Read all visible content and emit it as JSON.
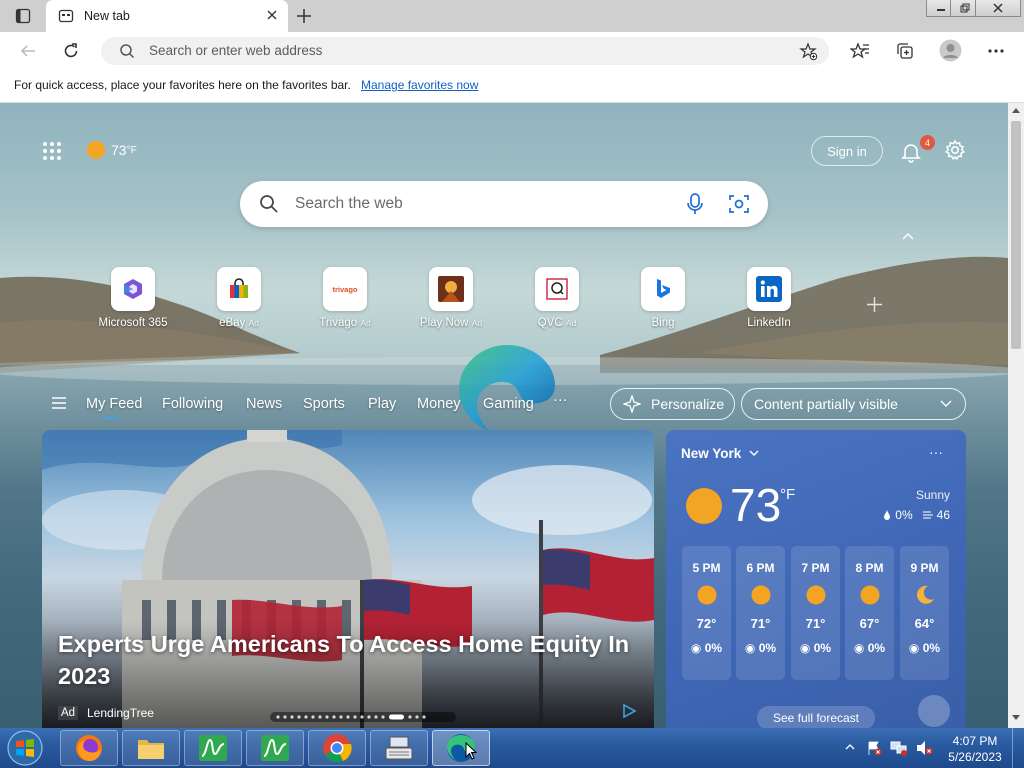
{
  "browser": {
    "tab_title": "New tab",
    "address_placeholder": "Search or enter web address",
    "favorites_message": "For quick access, place your favorites here on the favorites bar.",
    "favorites_link": "Manage favorites now"
  },
  "ntp": {
    "weather_temp": "73",
    "weather_unit": "°F",
    "sign_in": "Sign in",
    "notification_count": "4",
    "search_placeholder": "Search the web",
    "quick_links": [
      {
        "label": "Microsoft 365",
        "ad": ""
      },
      {
        "label": "eBay",
        "ad": "Ad"
      },
      {
        "label": "Trivago",
        "ad": "Ad"
      },
      {
        "label": "Play Now",
        "ad": "Ad"
      },
      {
        "label": "QVC",
        "ad": "Ad"
      },
      {
        "label": "Bing",
        "ad": ""
      },
      {
        "label": "LinkedIn",
        "ad": ""
      }
    ],
    "trivago_tile_text": "trivago",
    "feed_tabs": [
      "My Feed",
      "Following",
      "News",
      "Sports",
      "Play",
      "Money",
      "Gaming"
    ],
    "more_tabs": "···",
    "personalize": "Personalize",
    "content_visibility": "Content partially visible"
  },
  "hero": {
    "headline": "Experts Urge Americans To Access Home Equity In 2023",
    "ad_badge": "Ad",
    "source": "LendingTree"
  },
  "weather": {
    "city": "New York",
    "temp": "73",
    "unit": "°F",
    "condition": "Sunny",
    "precip": "0%",
    "humidity": "46",
    "hourly": [
      {
        "time": "5 PM",
        "icon": "sun-icon",
        "temp": "72°",
        "precip": "0%"
      },
      {
        "time": "6 PM",
        "icon": "sun-icon",
        "temp": "71°",
        "precip": "0%"
      },
      {
        "time": "7 PM",
        "icon": "sun-icon",
        "temp": "71°",
        "precip": "0%"
      },
      {
        "time": "8 PM",
        "icon": "sun-icon",
        "temp": "67°",
        "precip": "0%"
      },
      {
        "time": "9 PM",
        "icon": "moon-icon",
        "temp": "64°",
        "precip": "0%"
      }
    ],
    "see_forecast": "See full forecast"
  },
  "taskbar": {
    "time": "4:07 PM",
    "date": "5/26/2023"
  },
  "colors": {
    "accent": "#1060c8",
    "weather_card": "#4a73c0",
    "taskbar": "#2a5aa0"
  }
}
